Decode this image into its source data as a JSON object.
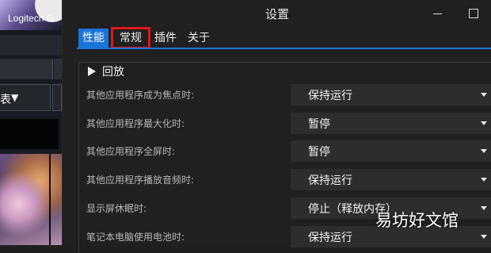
{
  "background_app": {
    "title": "Logitech G",
    "dropdown_text": "表"
  },
  "window": {
    "title": "设置"
  },
  "tabs": [
    {
      "label": "性能",
      "active": true
    },
    {
      "label": "常规",
      "active": false,
      "highlighted": true
    },
    {
      "label": "插件",
      "active": false
    },
    {
      "label": "关于",
      "active": false
    }
  ],
  "section": {
    "title": "回放",
    "rows": [
      {
        "label": "其他应用程序成为焦点时:",
        "value": "保持运行"
      },
      {
        "label": "其他应用程序最大化时:",
        "value": "暂停"
      },
      {
        "label": "其他应用程序全屏时:",
        "value": "暂停"
      },
      {
        "label": "其他应用程序播放音频时:",
        "value": "保持运行"
      },
      {
        "label": "显示屏休眠时:",
        "value": "停止（释放内存）"
      },
      {
        "label": "笔记本电脑使用电池时:",
        "value": "保持运行"
      }
    ]
  },
  "watermark": "易坊好文馆",
  "colors": {
    "accent": "#1a73d9",
    "highlight_box": "#e01818",
    "window_bg": "#202020",
    "select_bg": "#2d2d2d"
  },
  "icons": {
    "minimize": "minimize-icon",
    "maximize": "maximize-icon",
    "section_toggle": "triangle-right-icon",
    "dropdown": "chevron-down-icon"
  }
}
